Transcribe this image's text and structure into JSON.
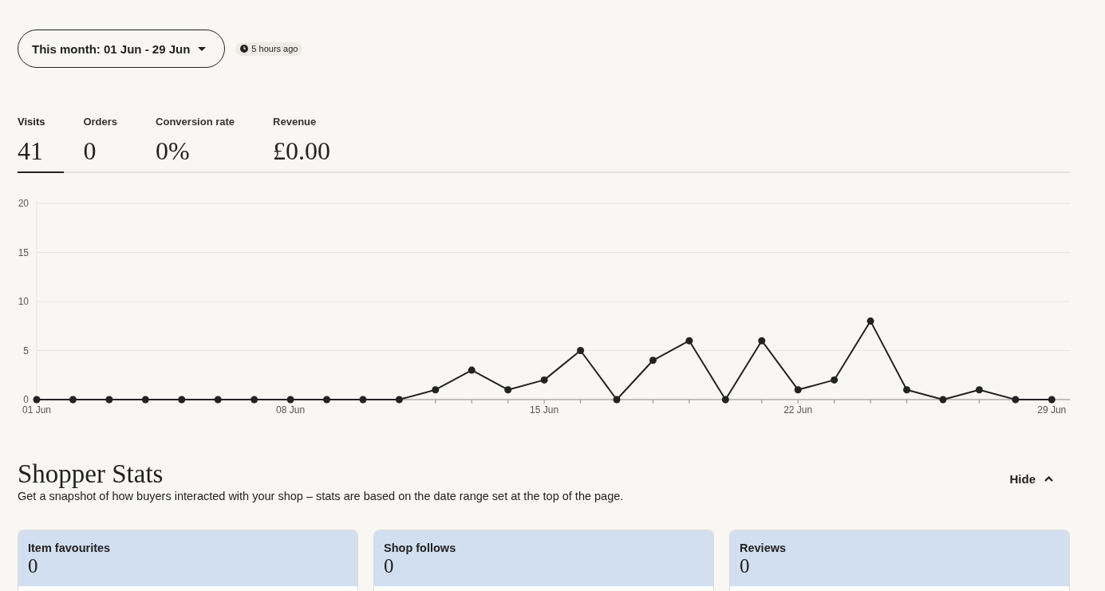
{
  "date_range": {
    "label": "This month: 01 Jun - 29 Jun"
  },
  "updated_badge": {
    "text": "5 hours ago"
  },
  "metrics": [
    {
      "label": "Visits",
      "value": "41",
      "selected": true
    },
    {
      "label": "Orders",
      "value": "0",
      "selected": false
    },
    {
      "label": "Conversion rate",
      "value": "0%",
      "selected": false
    },
    {
      "label": "Revenue",
      "value": "£0.00",
      "selected": false
    }
  ],
  "chart": {
    "chart_data": {
      "type": "line",
      "categories": [
        "01 Jun",
        null,
        null,
        null,
        null,
        null,
        null,
        "08 Jun",
        null,
        null,
        null,
        null,
        null,
        null,
        "15 Jun",
        null,
        null,
        null,
        null,
        null,
        null,
        "22 Jun",
        null,
        null,
        null,
        null,
        null,
        null,
        "29 Jun"
      ],
      "values": [
        0,
        0,
        0,
        0,
        0,
        0,
        0,
        0,
        0,
        0,
        0,
        1,
        3,
        1,
        2,
        5,
        0,
        4,
        6,
        0,
        6,
        1,
        2,
        8,
        1,
        0,
        1,
        0,
        0
      ],
      "ylim": [
        0,
        20
      ],
      "yticks": [
        0,
        5,
        10,
        15,
        20
      ],
      "grid": true,
      "marker": true
    }
  },
  "shopper_stats": {
    "title": "Shopper Stats",
    "description": "Get a snapshot of how buyers interacted with your shop – stats are based on the date range set at the top of the page.",
    "toggle": {
      "label": "Hide",
      "expanded": true
    },
    "cards": [
      {
        "label": "Item favourites",
        "value": "0"
      },
      {
        "label": "Shop follows",
        "value": "0"
      },
      {
        "label": "Reviews",
        "value": "0"
      }
    ]
  }
}
